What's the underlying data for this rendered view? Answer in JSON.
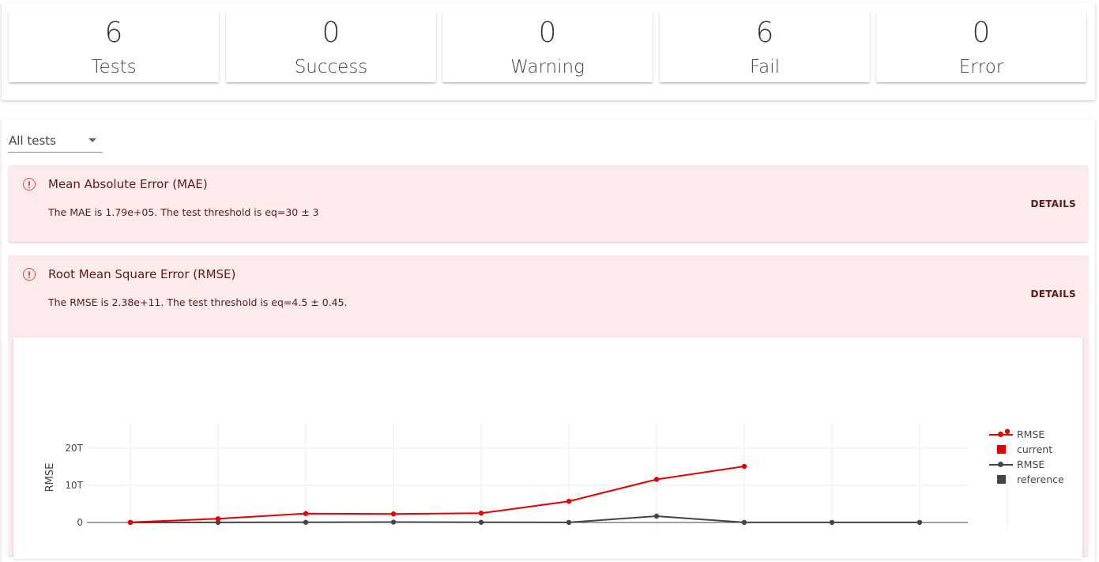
{
  "summary": {
    "cards": [
      {
        "value": "6",
        "label": "Tests"
      },
      {
        "value": "0",
        "label": "Success"
      },
      {
        "value": "0",
        "label": "Warning"
      },
      {
        "value": "6",
        "label": "Fail"
      },
      {
        "value": "0",
        "label": "Error"
      }
    ]
  },
  "filter": {
    "selected": "All tests"
  },
  "alerts": [
    {
      "title": "Mean Absolute Error (MAE)",
      "description": "The MAE is 1.79e+05. The test threshold is eq=30 ± 3",
      "details_label": "DETAILS"
    },
    {
      "title": "Root Mean Square Error (RMSE)",
      "description": "The RMSE is 2.38e+11. The test threshold is eq=4.5 ± 0.45.",
      "details_label": "DETAILS"
    }
  ],
  "colors": {
    "current": "#e00000",
    "reference": "#444444",
    "alert_bg": "#fdeaea",
    "alert_icon": "#e04a4a"
  },
  "chart_data": {
    "type": "line",
    "ylabel": "RMSE",
    "yticks": [
      "0",
      "10T",
      "20T"
    ],
    "ylim": [
      -2,
      27
    ],
    "x": [
      1,
      2,
      3,
      4,
      5,
      6,
      7,
      8,
      9,
      10,
      11
    ],
    "series": [
      {
        "name": "RMSE",
        "color": "#e00000",
        "values": [
          0.05,
          1.0,
          2.4,
          2.3,
          2.5,
          5.7,
          11.6,
          15.1,
          null,
          null,
          24.5
        ]
      },
      {
        "name": "RMSE",
        "color": "#444444",
        "values": [
          0.0,
          0.02,
          0.05,
          0.1,
          0.05,
          0.02,
          1.7,
          0.02,
          0.02,
          0.02,
          null
        ]
      }
    ],
    "legend": [
      "RMSE",
      "current",
      "RMSE",
      "reference"
    ],
    "legend_position": "right",
    "grid": true
  }
}
